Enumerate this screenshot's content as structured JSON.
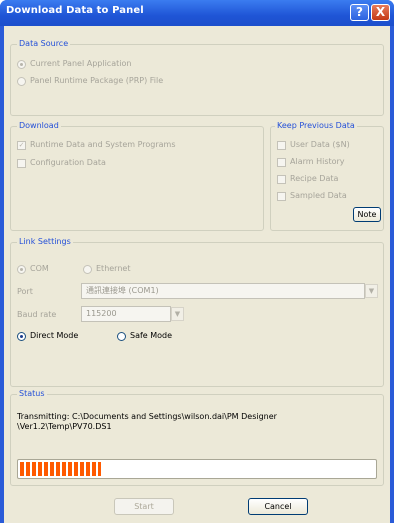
{
  "window": {
    "title": "Download Data to Panel",
    "help_label": "?",
    "close_label": "X"
  },
  "data_source": {
    "label": "Data Source",
    "options": [
      "Current Panel Application",
      "Panel Runtime Package (PRP) File"
    ]
  },
  "download": {
    "label": "Download",
    "items": [
      {
        "label": "Runtime Data and System Programs",
        "checked": true
      },
      {
        "label": "Configuration Data",
        "checked": false
      }
    ]
  },
  "keep_previous": {
    "label": "Keep Previous Data",
    "items": [
      "User Data ($N)",
      "Alarm History",
      "Recipe Data",
      "Sampled Data"
    ],
    "note_label": "Note"
  },
  "link_settings": {
    "label": "Link Settings",
    "com_label": "COM",
    "ethernet_label": "Ethernet",
    "port_label": "Port",
    "port_value": "通訊連接埠 (COM1)",
    "baud_label": "Baud rate",
    "baud_value": "115200",
    "direct_mode_label": "Direct Mode",
    "safe_mode_label": "Safe Mode"
  },
  "status": {
    "label": "Status",
    "message": "Transmitting: C:\\Documents and Settings\\wilson.dai\\PM Designer\\Ver1.2\\Temp\\PV70.DS1",
    "progress": 0.23,
    "progress_color": "#ff5a00"
  },
  "buttons": {
    "start_label": "Start",
    "cancel_label": "Cancel"
  }
}
